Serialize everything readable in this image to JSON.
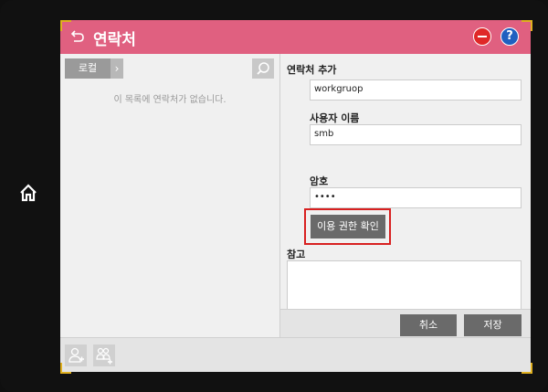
{
  "header": {
    "title": "연락처"
  },
  "left_pane": {
    "local_button": "로컬",
    "expand_glyph": "›",
    "empty_message": "이 목록에 연락처가 없습니다."
  },
  "form": {
    "panel_title": "연락처 추가",
    "workgroup_value": "workgruop",
    "username_label": "사용자 이름",
    "username_value": "smb",
    "password_label": "암호",
    "password_value": "••••",
    "check_permission_button": "이용 권한 확인",
    "notes_label": "참고",
    "cancel_button": "취소",
    "save_button": "저장"
  },
  "icons": {
    "home": "home-icon",
    "back": "back-icon",
    "stop": "stop-icon",
    "help": "help-icon",
    "search": "search-icon",
    "add_contact": "add-contact-icon",
    "add_group": "add-group-icon"
  },
  "header_help_glyph": "?",
  "colors": {
    "titlebar": "#e06080",
    "button": "#6a6a6a",
    "highlight": "#d82020",
    "stop": "#e02828",
    "help": "#2060c0"
  }
}
